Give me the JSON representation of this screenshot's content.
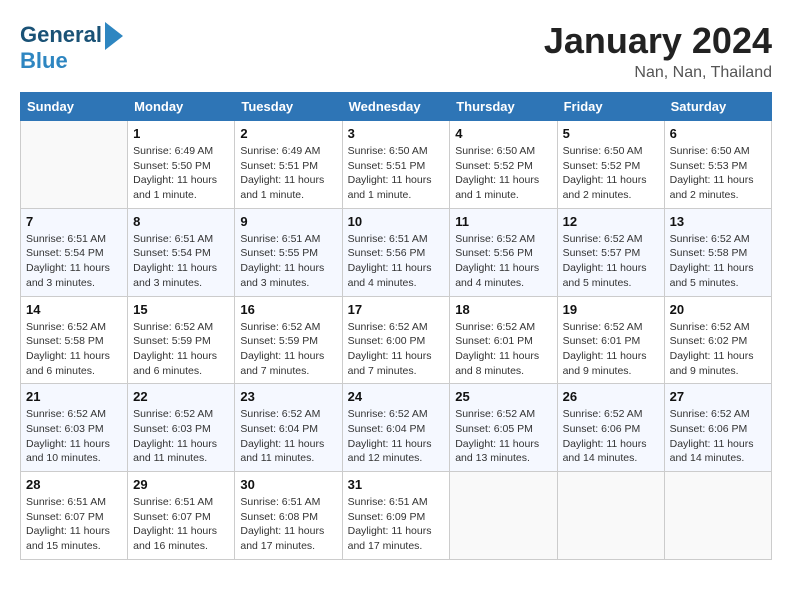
{
  "header": {
    "logo_line1": "General",
    "logo_line2": "Blue",
    "month_title": "January 2024",
    "location": "Nan, Nan, Thailand"
  },
  "columns": [
    "Sunday",
    "Monday",
    "Tuesday",
    "Wednesday",
    "Thursday",
    "Friday",
    "Saturday"
  ],
  "weeks": [
    [
      {
        "day": "",
        "info": ""
      },
      {
        "day": "1",
        "info": "Sunrise: 6:49 AM\nSunset: 5:50 PM\nDaylight: 11 hours\nand 1 minute."
      },
      {
        "day": "2",
        "info": "Sunrise: 6:49 AM\nSunset: 5:51 PM\nDaylight: 11 hours\nand 1 minute."
      },
      {
        "day": "3",
        "info": "Sunrise: 6:50 AM\nSunset: 5:51 PM\nDaylight: 11 hours\nand 1 minute."
      },
      {
        "day": "4",
        "info": "Sunrise: 6:50 AM\nSunset: 5:52 PM\nDaylight: 11 hours\nand 1 minute."
      },
      {
        "day": "5",
        "info": "Sunrise: 6:50 AM\nSunset: 5:52 PM\nDaylight: 11 hours\nand 2 minutes."
      },
      {
        "day": "6",
        "info": "Sunrise: 6:50 AM\nSunset: 5:53 PM\nDaylight: 11 hours\nand 2 minutes."
      }
    ],
    [
      {
        "day": "7",
        "info": "Sunrise: 6:51 AM\nSunset: 5:54 PM\nDaylight: 11 hours\nand 3 minutes."
      },
      {
        "day": "8",
        "info": "Sunrise: 6:51 AM\nSunset: 5:54 PM\nDaylight: 11 hours\nand 3 minutes."
      },
      {
        "day": "9",
        "info": "Sunrise: 6:51 AM\nSunset: 5:55 PM\nDaylight: 11 hours\nand 3 minutes."
      },
      {
        "day": "10",
        "info": "Sunrise: 6:51 AM\nSunset: 5:56 PM\nDaylight: 11 hours\nand 4 minutes."
      },
      {
        "day": "11",
        "info": "Sunrise: 6:52 AM\nSunset: 5:56 PM\nDaylight: 11 hours\nand 4 minutes."
      },
      {
        "day": "12",
        "info": "Sunrise: 6:52 AM\nSunset: 5:57 PM\nDaylight: 11 hours\nand 5 minutes."
      },
      {
        "day": "13",
        "info": "Sunrise: 6:52 AM\nSunset: 5:58 PM\nDaylight: 11 hours\nand 5 minutes."
      }
    ],
    [
      {
        "day": "14",
        "info": "Sunrise: 6:52 AM\nSunset: 5:58 PM\nDaylight: 11 hours\nand 6 minutes."
      },
      {
        "day": "15",
        "info": "Sunrise: 6:52 AM\nSunset: 5:59 PM\nDaylight: 11 hours\nand 6 minutes."
      },
      {
        "day": "16",
        "info": "Sunrise: 6:52 AM\nSunset: 5:59 PM\nDaylight: 11 hours\nand 7 minutes."
      },
      {
        "day": "17",
        "info": "Sunrise: 6:52 AM\nSunset: 6:00 PM\nDaylight: 11 hours\nand 7 minutes."
      },
      {
        "day": "18",
        "info": "Sunrise: 6:52 AM\nSunset: 6:01 PM\nDaylight: 11 hours\nand 8 minutes."
      },
      {
        "day": "19",
        "info": "Sunrise: 6:52 AM\nSunset: 6:01 PM\nDaylight: 11 hours\nand 9 minutes."
      },
      {
        "day": "20",
        "info": "Sunrise: 6:52 AM\nSunset: 6:02 PM\nDaylight: 11 hours\nand 9 minutes."
      }
    ],
    [
      {
        "day": "21",
        "info": "Sunrise: 6:52 AM\nSunset: 6:03 PM\nDaylight: 11 hours\nand 10 minutes."
      },
      {
        "day": "22",
        "info": "Sunrise: 6:52 AM\nSunset: 6:03 PM\nDaylight: 11 hours\nand 11 minutes."
      },
      {
        "day": "23",
        "info": "Sunrise: 6:52 AM\nSunset: 6:04 PM\nDaylight: 11 hours\nand 11 minutes."
      },
      {
        "day": "24",
        "info": "Sunrise: 6:52 AM\nSunset: 6:04 PM\nDaylight: 11 hours\nand 12 minutes."
      },
      {
        "day": "25",
        "info": "Sunrise: 6:52 AM\nSunset: 6:05 PM\nDaylight: 11 hours\nand 13 minutes."
      },
      {
        "day": "26",
        "info": "Sunrise: 6:52 AM\nSunset: 6:06 PM\nDaylight: 11 hours\nand 14 minutes."
      },
      {
        "day": "27",
        "info": "Sunrise: 6:52 AM\nSunset: 6:06 PM\nDaylight: 11 hours\nand 14 minutes."
      }
    ],
    [
      {
        "day": "28",
        "info": "Sunrise: 6:51 AM\nSunset: 6:07 PM\nDaylight: 11 hours\nand 15 minutes."
      },
      {
        "day": "29",
        "info": "Sunrise: 6:51 AM\nSunset: 6:07 PM\nDaylight: 11 hours\nand 16 minutes."
      },
      {
        "day": "30",
        "info": "Sunrise: 6:51 AM\nSunset: 6:08 PM\nDaylight: 11 hours\nand 17 minutes."
      },
      {
        "day": "31",
        "info": "Sunrise: 6:51 AM\nSunset: 6:09 PM\nDaylight: 11 hours\nand 17 minutes."
      },
      {
        "day": "",
        "info": ""
      },
      {
        "day": "",
        "info": ""
      },
      {
        "day": "",
        "info": ""
      }
    ]
  ]
}
